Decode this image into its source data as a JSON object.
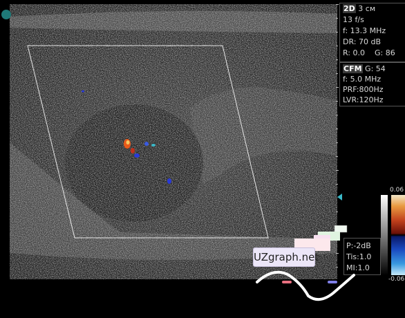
{
  "mode_2d": {
    "mode_label": "2D",
    "depth": "3 см",
    "frame_rate": "13 f/s",
    "frequency": "f: 13.3 MHz",
    "dynamic_range": "DR: 70 dB",
    "rejection": "R: 0.0",
    "gain": "G: 86"
  },
  "cfm": {
    "mode_label": "CFM",
    "gain": "G: 54",
    "frequency": "f: 5.0 MHz",
    "prf": "PRF:800Hz",
    "lvr": "LVR:120Hz"
  },
  "probe": {
    "power": "P:-2dB",
    "tis": "Tis:1.0",
    "mi": "MI:1.0"
  },
  "color_scale": {
    "max": "0.06",
    "min": "-0.06"
  },
  "watermark": "UZgraph.net",
  "colors": {
    "background": "#000000",
    "roi_outline": "#e8e8e8",
    "flow_red": "#e85a1a",
    "flow_blue": "#2a3ad8",
    "focus_marker": "#3ab8c8"
  }
}
